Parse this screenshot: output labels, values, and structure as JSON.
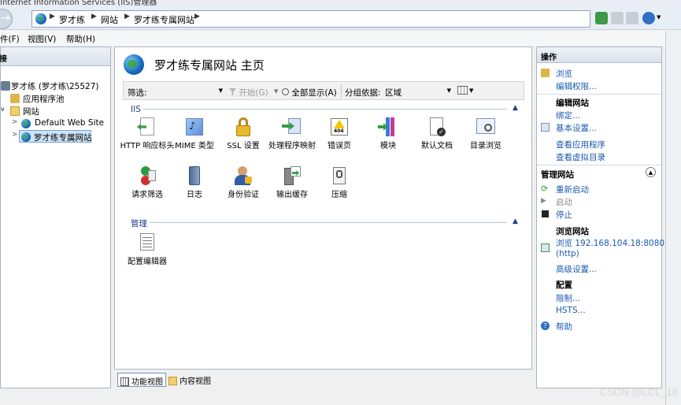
{
  "window": {
    "title": "Internet Information Services (IIS)管理器"
  },
  "address": {
    "crumbs": [
      "罗才练",
      "网站",
      "罗才练专属网站"
    ]
  },
  "menu": {
    "items": [
      "件(F)",
      "视图(V)",
      "帮助(H)"
    ]
  },
  "connections": {
    "header": "接",
    "tree": [
      {
        "label": "罗才练 (罗才练\\25527)",
        "icon": "server-icon",
        "level": 0,
        "expander": ""
      },
      {
        "label": "应用程序池",
        "icon": "app-pool-icon",
        "level": 1,
        "expander": ""
      },
      {
        "label": "网站",
        "icon": "folder-icon",
        "level": 1,
        "expander": "v"
      },
      {
        "label": "Default Web Site",
        "icon": "globe-icon",
        "level": 2,
        "expander": ">"
      },
      {
        "label": "罗才练专属网站",
        "icon": "globe-icon",
        "level": 2,
        "expander": ">",
        "selected": true
      }
    ]
  },
  "center": {
    "title": "罗才练专属网站 主页",
    "filter": {
      "label": "筛选:",
      "start": "开始(G)",
      "show_all": "全部显示(A)",
      "group_label": "分组依据:",
      "group_value": "区域"
    },
    "sections": [
      {
        "name": "IIS",
        "features": [
          {
            "label": "HTTP 响应标头",
            "icon": "http-response-headers-icon"
          },
          {
            "label": "MIME 类型",
            "icon": "mime-types-icon"
          },
          {
            "label": "SSL 设置",
            "icon": "ssl-lock-icon"
          },
          {
            "label": "处理程序映射",
            "icon": "handler-mappings-icon"
          },
          {
            "label": "错误页",
            "icon": "error-pages-icon"
          },
          {
            "label": "模块",
            "icon": "modules-icon"
          },
          {
            "label": "默认文档",
            "icon": "default-document-icon"
          },
          {
            "label": "目录浏览",
            "icon": "directory-browsing-icon"
          },
          {
            "label": "请求筛选",
            "icon": "request-filtering-icon"
          },
          {
            "label": "日志",
            "icon": "logging-icon"
          },
          {
            "label": "身份验证",
            "icon": "authentication-icon"
          },
          {
            "label": "输出缓存",
            "icon": "output-caching-icon"
          },
          {
            "label": "压缩",
            "icon": "compression-icon"
          }
        ]
      },
      {
        "name": "管理",
        "features": [
          {
            "label": "配置编辑器",
            "icon": "configuration-editor-icon"
          }
        ]
      }
    ],
    "view_tabs": [
      "功能视图",
      "内容视图"
    ]
  },
  "actions": {
    "header": "操作",
    "explore": "浏览",
    "edit_permissions": "编辑权限...",
    "edit_site": "编辑网站",
    "bindings": "绑定...",
    "basic_settings": "基本设置...",
    "view_applications": "查看应用程序",
    "view_virtual_dirs": "查看虚拟目录",
    "manage_site": "管理网站",
    "restart": "重新启动",
    "start": "启动",
    "stop": "停止",
    "browse_site": "浏览网站",
    "browse_address": "浏览 192.168.104.18:8080",
    "browse_protocol": "(http)",
    "advanced_settings": "高级设置...",
    "configure": "配置",
    "limits": "限制...",
    "hsts": "HSTS...",
    "help": "帮助"
  },
  "watermark": "CSDN @LCL_18"
}
